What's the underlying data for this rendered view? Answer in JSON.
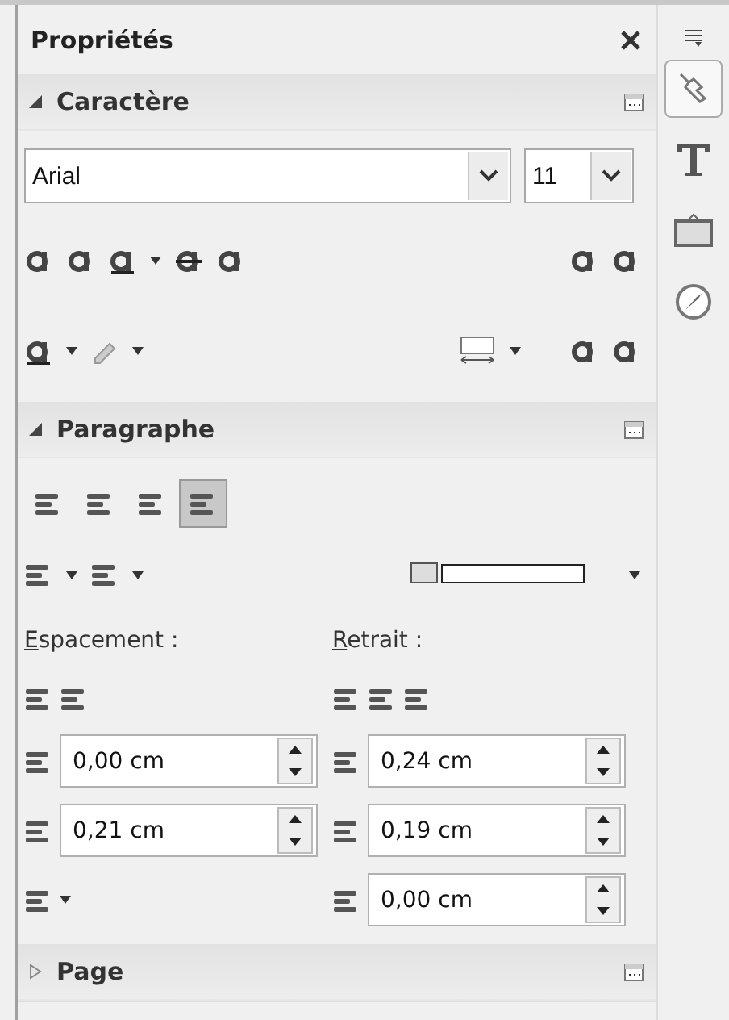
{
  "title": "Propriétés",
  "sections": [
    {
      "kind": "character",
      "title": "Caractère",
      "expanded": true,
      "font": "Arial",
      "size": "11"
    },
    {
      "kind": "paragraph",
      "title": "Paragraphe",
      "expanded": true,
      "alignments": [
        {
          "selected": false
        },
        {
          "selected": false
        },
        {
          "selected": false
        },
        {
          "selected": true
        }
      ],
      "spacing_label": "Espacement :",
      "indent_label": "Retrait :",
      "above": "0,00 cm",
      "below": "0,21 cm",
      "before": "0,24 cm",
      "after": "0,19 cm",
      "first_line": "0,00 cm"
    },
    {
      "kind": "page",
      "title": "Page",
      "expanded": false
    }
  ],
  "tabs": [
    {
      "selected": true
    },
    {
      "selected": false
    },
    {
      "selected": false
    },
    {
      "selected": false
    }
  ]
}
